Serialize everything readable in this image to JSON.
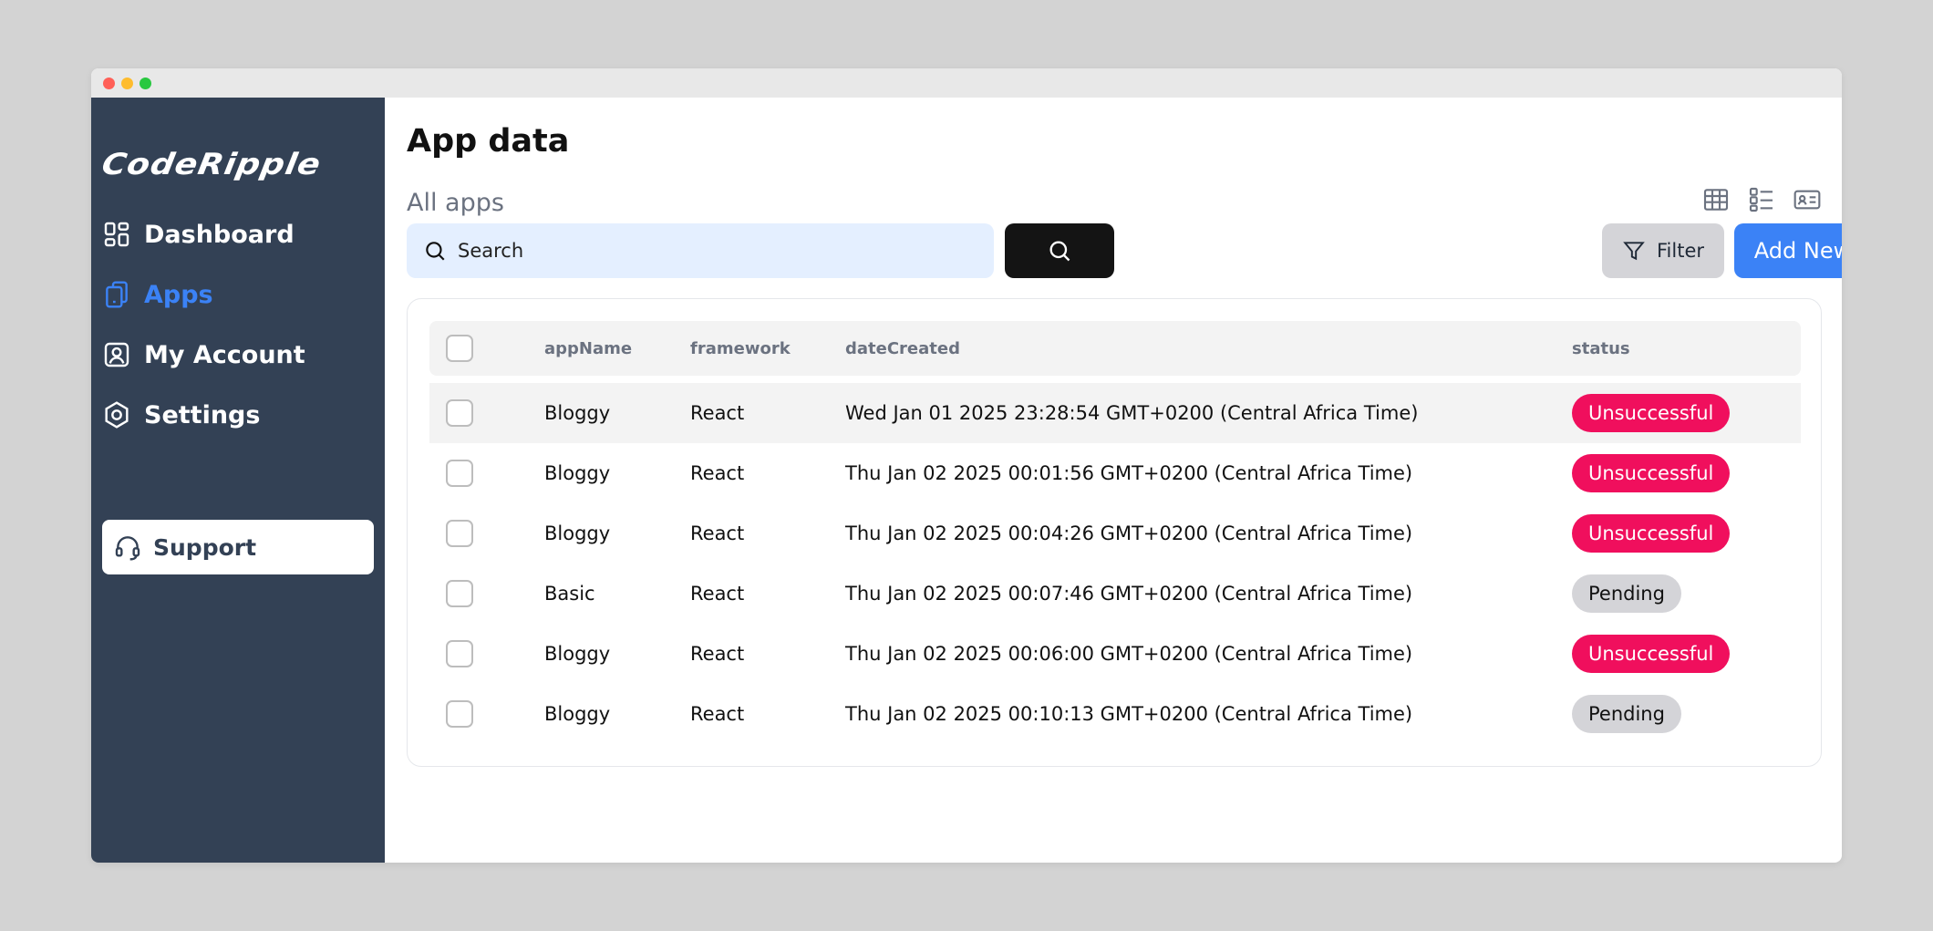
{
  "brand": {
    "name": "CodeRipple"
  },
  "sidebar": {
    "items": [
      {
        "label": "Dashboard",
        "icon": "dashboard-icon",
        "active": false
      },
      {
        "label": "Apps",
        "icon": "tablet-icon",
        "active": true
      },
      {
        "label": "My Account",
        "icon": "user-square-icon",
        "active": false
      },
      {
        "label": "Settings",
        "icon": "hexagon-settings-icon",
        "active": false
      }
    ],
    "support": {
      "label": "Support",
      "icon": "headset-icon"
    }
  },
  "main": {
    "title": "App data",
    "section_title": "All apps",
    "view_icons": [
      "table-view-icon",
      "list-view-icon",
      "card-view-icon"
    ],
    "search": {
      "placeholder": "Search",
      "value": ""
    },
    "filter_label": "Filter",
    "add_new_label": "Add New"
  },
  "table": {
    "columns": [
      "appName",
      "framework",
      "dateCreated",
      "status"
    ],
    "rows": [
      {
        "appName": "Bloggy",
        "framework": "React",
        "dateCreated": "Wed Jan 01 2025 23:28:54 GMT+0200 (Central Africa Time)",
        "status": "Unsuccessful"
      },
      {
        "appName": "Bloggy",
        "framework": "React",
        "dateCreated": "Thu Jan 02 2025 00:01:56 GMT+0200 (Central Africa Time)",
        "status": "Unsuccessful"
      },
      {
        "appName": "Bloggy",
        "framework": "React",
        "dateCreated": "Thu Jan 02 2025 00:04:26 GMT+0200 (Central Africa Time)",
        "status": "Unsuccessful"
      },
      {
        "appName": "Basic",
        "framework": "React",
        "dateCreated": "Thu Jan 02 2025 00:07:46 GMT+0200 (Central Africa Time)",
        "status": "Pending"
      },
      {
        "appName": "Bloggy",
        "framework": "React",
        "dateCreated": "Thu Jan 02 2025 00:06:00 GMT+0200 (Central Africa Time)",
        "status": "Unsuccessful"
      },
      {
        "appName": "Bloggy",
        "framework": "React",
        "dateCreated": "Thu Jan 02 2025 00:10:13 GMT+0200 (Central Africa Time)",
        "status": "Pending"
      }
    ]
  },
  "colors": {
    "sidebar_bg": "#334155",
    "accent": "#3b82f6",
    "unsuccessful": "#f00f5d",
    "pending": "#d4d4d8"
  }
}
